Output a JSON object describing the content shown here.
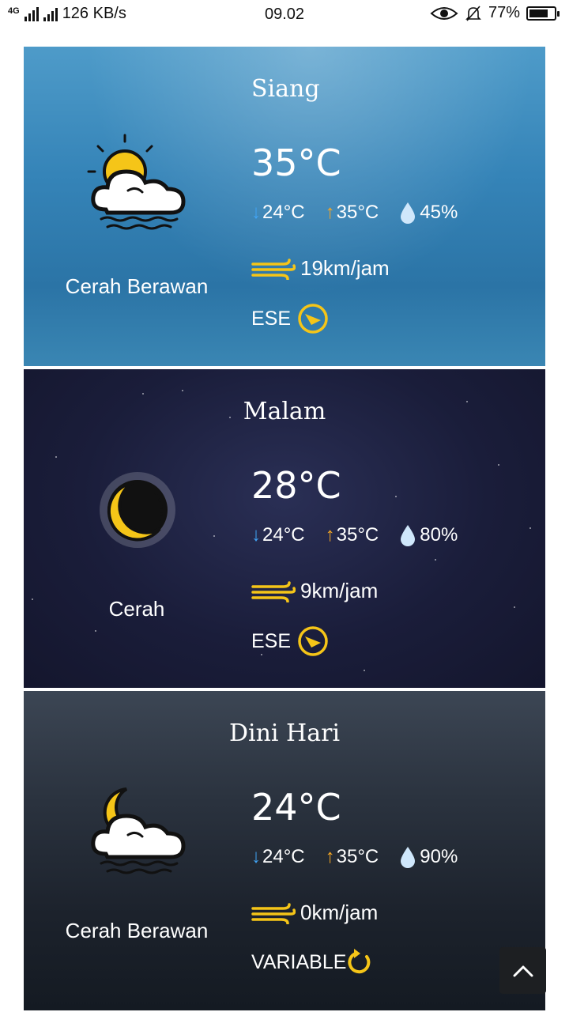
{
  "status_bar": {
    "network": "4G",
    "speed": "126 KB/s",
    "time": "09.02",
    "battery": "77%",
    "battery_level": 0.77
  },
  "cards": [
    {
      "period": "Siang",
      "temperature": "35°C",
      "min_temp": "24°C",
      "max_temp": "35°C",
      "humidity": "45%",
      "wind_speed": "19km/jam",
      "wind_direction": "ESE",
      "condition": "Cerah Berawan",
      "condition_icon": "sun-cloud-icon"
    },
    {
      "period": "Malam",
      "temperature": "28°C",
      "min_temp": "24°C",
      "max_temp": "35°C",
      "humidity": "80%",
      "wind_speed": "9km/jam",
      "wind_direction": "ESE",
      "condition": "Cerah",
      "condition_icon": "moon-icon"
    },
    {
      "period": "Dini Hari",
      "temperature": "24°C",
      "min_temp": "24°C",
      "max_temp": "35°C",
      "humidity": "90%",
      "wind_speed": "0km/jam",
      "wind_direction": "VARIABLE",
      "condition": "Cerah Berawan",
      "condition_icon": "moon-cloud-icon"
    }
  ],
  "colors": {
    "accent_yellow": "#f5c518",
    "arrow_down": "#41a4f5",
    "arrow_up": "#f5a623",
    "drop": "#cfe7fb"
  }
}
